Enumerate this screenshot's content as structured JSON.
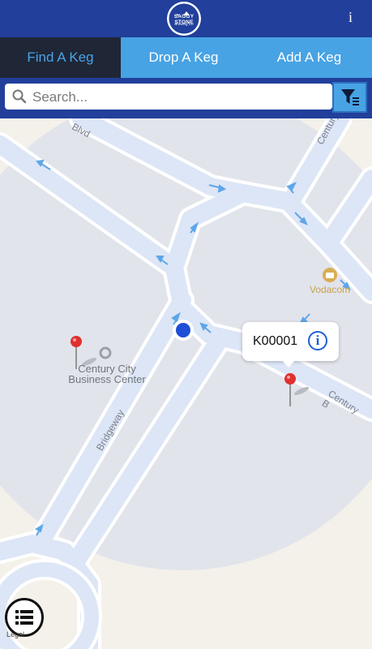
{
  "header": {
    "logo_text": "SAGGY STONE",
    "logo_subtext": "Brewing Co",
    "info_icon": "info-i-icon",
    "brand_color": "#213f9b"
  },
  "tabs": [
    {
      "label": "Find A Keg",
      "active": true
    },
    {
      "label": "Drop A Keg",
      "active": false
    },
    {
      "label": "Add A Keg",
      "active": false
    }
  ],
  "search": {
    "placeholder": "Search...",
    "value": "",
    "filter_icon": "filter-icon"
  },
  "map": {
    "road_labels": [
      "Blvd",
      "Century",
      "Bridgeway",
      "Century B"
    ],
    "poi": {
      "name_line1": "Century City",
      "name_line2": "Business Center"
    },
    "vodacom": "Vodacom",
    "callout": {
      "keg_id": "K00001"
    }
  },
  "bottom": {
    "list_icon": "list-icon",
    "legal": "Legal"
  },
  "colors": {
    "accent": "#47a3e4",
    "active_tab": "#1f2636",
    "pin": "#e0302e",
    "location_dot": "#1e4fd6"
  }
}
